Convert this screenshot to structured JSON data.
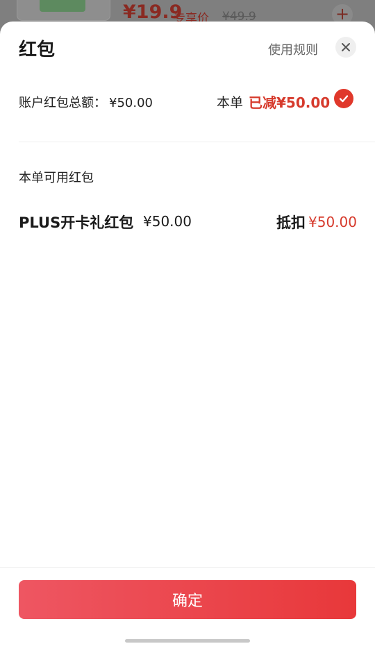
{
  "background": {
    "price": "¥19.9",
    "tag": "专享价",
    "original_price": "¥49.9",
    "add_icon": "plus-icon"
  },
  "sheet": {
    "title": "红包",
    "rules_link": "使用规则",
    "close_icon": "close-icon",
    "total_label": "账户红包总额：",
    "total_value": "¥50.00",
    "order_label": "本单",
    "reduced_text": "已减¥50.00",
    "check_icon": "checkmark-icon",
    "section_label": "本单可用红包",
    "packets": [
      {
        "name": "PLUS开卡礼红包",
        "amount": "¥50.00",
        "deduct_label": "抵扣",
        "deduct_amount": "¥50.00"
      }
    ],
    "confirm_label": "确定"
  },
  "colors": {
    "accent": "#e0382b",
    "button_gradient_start": "#ee5662",
    "button_gradient_end": "#e8383a"
  }
}
